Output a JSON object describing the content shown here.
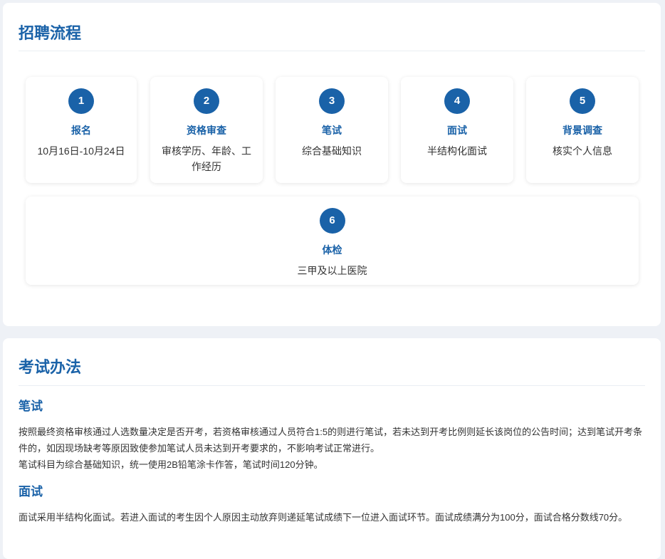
{
  "process": {
    "title": "招聘流程",
    "steps": [
      {
        "num": "1",
        "name": "报名",
        "desc": "10月16日-10月24日"
      },
      {
        "num": "2",
        "name": "资格审查",
        "desc": "审核学历、年龄、工作经历"
      },
      {
        "num": "3",
        "name": "笔试",
        "desc": "综合基础知识"
      },
      {
        "num": "4",
        "name": "面试",
        "desc": "半结构化面试"
      },
      {
        "num": "5",
        "name": "背景调查",
        "desc": "核实个人信息"
      },
      {
        "num": "6",
        "name": "体检",
        "desc": "三甲及以上医院"
      }
    ]
  },
  "exam": {
    "title": "考试办法",
    "written": {
      "heading": "笔试",
      "para1": "按照最终资格审核通过人选数量决定是否开考，若资格审核通过人员符合1:5的则进行笔试，若未达到开考比例则延长该岗位的公告时间；达到笔试开考条件的，如因现场缺考等原因致使参加笔试人员未达到开考要求的，不影响考试正常进行。",
      "para2": "笔试科目为综合基础知识，统一使用2B铅笔涂卡作答，笔试时间120分钟。"
    },
    "interview": {
      "heading": "面试",
      "para1": "面试采用半结构化面试。若进入面试的考生因个人原因主动放弃则递延笔试成绩下一位进入面试环节。面试成绩满分为100分，面试合格分数线70分。"
    }
  }
}
